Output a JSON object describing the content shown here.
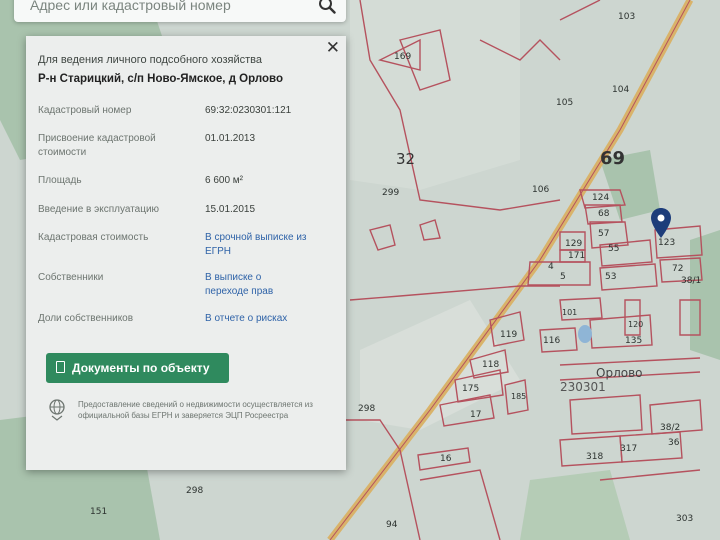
{
  "search": {
    "placeholder": "Адрес или кадастровый номер"
  },
  "panel": {
    "title_line1": "Для ведения личного подсобного хозяйства",
    "title_line2": "Р-н Старицкий, с/п Ново-Ямское, д Орлово",
    "rows": [
      {
        "label": "Кадастровый номер",
        "value": "69:32:0230301:121"
      },
      {
        "label": "Присвоение кадастровой стоимости",
        "value": "01.01.2013"
      },
      {
        "label": "Площадь",
        "value": "6 600 м²"
      },
      {
        "label": "Введение в эксплуатацию",
        "value": "15.01.2015"
      },
      {
        "label": "Кадастровая стоимость",
        "value": "В срочной выписке из ЕГРН"
      },
      {
        "label": "Собственники",
        "value": "В выписке о переходе прав"
      },
      {
        "label": "Доли собственников",
        "value": "В отчете о рисках"
      }
    ],
    "doc_button": "Документы по объекту",
    "note": "Предоставление сведений о недвижимости осуществляется из официальной базы ЕГРН и заверяется ЭЦП Росреестра"
  },
  "map": {
    "road_number": "69",
    "district_number": "32",
    "village_name": "Орлово",
    "quarter": "230301",
    "parcels": [
      "103",
      "169",
      "105",
      "104",
      "106",
      "299",
      "124",
      "68",
      "57",
      "55",
      "123",
      "129",
      "171",
      "4",
      "5",
      "53",
      "72",
      "38/1",
      "101",
      "116",
      "135",
      "119",
      "118",
      "175",
      "17",
      "185",
      "298",
      "16",
      "318",
      "317",
      "38/2",
      "36",
      "94",
      "151",
      "298",
      "303",
      "120"
    ]
  },
  "colors": {
    "accent": "#2f8a5e",
    "link": "#2f63a8",
    "parcel_line": "#b5525e",
    "road": "#d9b36a"
  }
}
